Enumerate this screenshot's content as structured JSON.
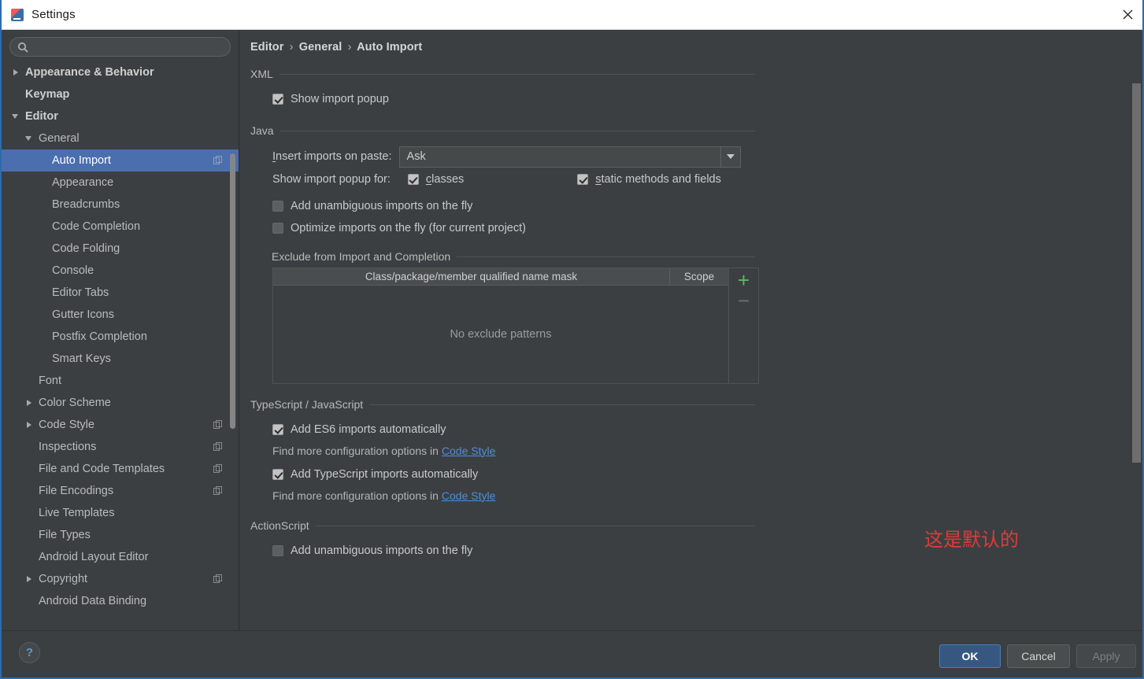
{
  "window": {
    "title": "Settings",
    "app_icon": "intellij-idea-icon",
    "close_icon": "close-icon"
  },
  "sidebar": {
    "search": {
      "value": "",
      "placeholder": "",
      "icon": "search-icon"
    },
    "items": [
      {
        "label": "Appearance & Behavior",
        "depth": 0,
        "arrow": "collapsed",
        "bold": true,
        "selected": false,
        "copy": false
      },
      {
        "label": "Keymap",
        "depth": 0,
        "arrow": "none",
        "bold": true,
        "selected": false,
        "copy": false
      },
      {
        "label": "Editor",
        "depth": 0,
        "arrow": "expanded",
        "bold": true,
        "selected": false,
        "copy": false
      },
      {
        "label": "General",
        "depth": 1,
        "arrow": "expanded",
        "bold": false,
        "selected": false,
        "copy": false
      },
      {
        "label": "Auto Import",
        "depth": 2,
        "arrow": "none",
        "bold": false,
        "selected": true,
        "copy": true
      },
      {
        "label": "Appearance",
        "depth": 2,
        "arrow": "none",
        "bold": false,
        "selected": false,
        "copy": false
      },
      {
        "label": "Breadcrumbs",
        "depth": 2,
        "arrow": "none",
        "bold": false,
        "selected": false,
        "copy": false
      },
      {
        "label": "Code Completion",
        "depth": 2,
        "arrow": "none",
        "bold": false,
        "selected": false,
        "copy": false
      },
      {
        "label": "Code Folding",
        "depth": 2,
        "arrow": "none",
        "bold": false,
        "selected": false,
        "copy": false
      },
      {
        "label": "Console",
        "depth": 2,
        "arrow": "none",
        "bold": false,
        "selected": false,
        "copy": false
      },
      {
        "label": "Editor Tabs",
        "depth": 2,
        "arrow": "none",
        "bold": false,
        "selected": false,
        "copy": false
      },
      {
        "label": "Gutter Icons",
        "depth": 2,
        "arrow": "none",
        "bold": false,
        "selected": false,
        "copy": false
      },
      {
        "label": "Postfix Completion",
        "depth": 2,
        "arrow": "none",
        "bold": false,
        "selected": false,
        "copy": false
      },
      {
        "label": "Smart Keys",
        "depth": 2,
        "arrow": "none",
        "bold": false,
        "selected": false,
        "copy": false
      },
      {
        "label": "Font",
        "depth": 1,
        "arrow": "none",
        "bold": false,
        "selected": false,
        "copy": false
      },
      {
        "label": "Color Scheme",
        "depth": 1,
        "arrow": "collapsed",
        "bold": false,
        "selected": false,
        "copy": false
      },
      {
        "label": "Code Style",
        "depth": 1,
        "arrow": "collapsed",
        "bold": false,
        "selected": false,
        "copy": true
      },
      {
        "label": "Inspections",
        "depth": 1,
        "arrow": "none",
        "bold": false,
        "selected": false,
        "copy": true
      },
      {
        "label": "File and Code Templates",
        "depth": 1,
        "arrow": "none",
        "bold": false,
        "selected": false,
        "copy": true
      },
      {
        "label": "File Encodings",
        "depth": 1,
        "arrow": "none",
        "bold": false,
        "selected": false,
        "copy": true
      },
      {
        "label": "Live Templates",
        "depth": 1,
        "arrow": "none",
        "bold": false,
        "selected": false,
        "copy": false
      },
      {
        "label": "File Types",
        "depth": 1,
        "arrow": "none",
        "bold": false,
        "selected": false,
        "copy": false
      },
      {
        "label": "Android Layout Editor",
        "depth": 1,
        "arrow": "none",
        "bold": false,
        "selected": false,
        "copy": false
      },
      {
        "label": "Copyright",
        "depth": 1,
        "arrow": "collapsed",
        "bold": false,
        "selected": false,
        "copy": true
      },
      {
        "label": "Android Data Binding",
        "depth": 1,
        "arrow": "none",
        "bold": false,
        "selected": false,
        "copy": false
      }
    ]
  },
  "content": {
    "breadcrumb": {
      "part1": "Editor",
      "part2": "General",
      "part3": "Auto Import",
      "separator": "›"
    },
    "xml": {
      "title": "XML",
      "show_import_popup": {
        "label": "Show import popup",
        "checked": true
      }
    },
    "java": {
      "title": "Java",
      "insert_imports_label": "Insert imports on paste:",
      "insert_imports_mnemonic": "I",
      "insert_imports_value": "Ask",
      "show_import_popup_for_label": "Show import popup for:",
      "classes": {
        "label": "classes",
        "mnemonic": "c",
        "checked": true
      },
      "static_methods": {
        "label": "static methods and fields",
        "mnemonic": "s",
        "checked": true
      },
      "add_unambiguous": {
        "label": "Add unambiguous imports on the fly",
        "checked": false
      },
      "optimize_imports": {
        "label": "Optimize imports on the fly (for current project)",
        "checked": false
      },
      "exclude": {
        "title": "Exclude from Import and Completion",
        "col_mask": "Class/package/member qualified name mask",
        "col_scope": "Scope",
        "empty_text": "No exclude patterns",
        "add_label": "+",
        "remove_label": "−"
      }
    },
    "typescript": {
      "title": "TypeScript / JavaScript",
      "es6": {
        "label": "Add ES6 imports automatically",
        "checked": true
      },
      "es6_hint": "Find more configuration options in",
      "es6_link": "Code Style",
      "ts": {
        "label": "Add TypeScript imports automatically",
        "checked": true
      },
      "ts_hint": "Find more configuration options in",
      "ts_link": "Code Style"
    },
    "actionscript": {
      "title": "ActionScript",
      "add_unambiguous": {
        "label": "Add unambiguous imports on the fly",
        "checked": false
      }
    },
    "annotation": "这是默认的"
  },
  "footer": {
    "help_label": "?",
    "ok_label": "OK",
    "cancel_label": "Cancel",
    "apply_label": "Apply"
  },
  "colors": {
    "background": "#3c3f41",
    "selection": "#4b6eaf",
    "link": "#4b8ede",
    "annotation": "#e03a3a",
    "ok_button": "#365880",
    "add_button": "#5fb85f",
    "window_border": "#2d6ca8"
  }
}
